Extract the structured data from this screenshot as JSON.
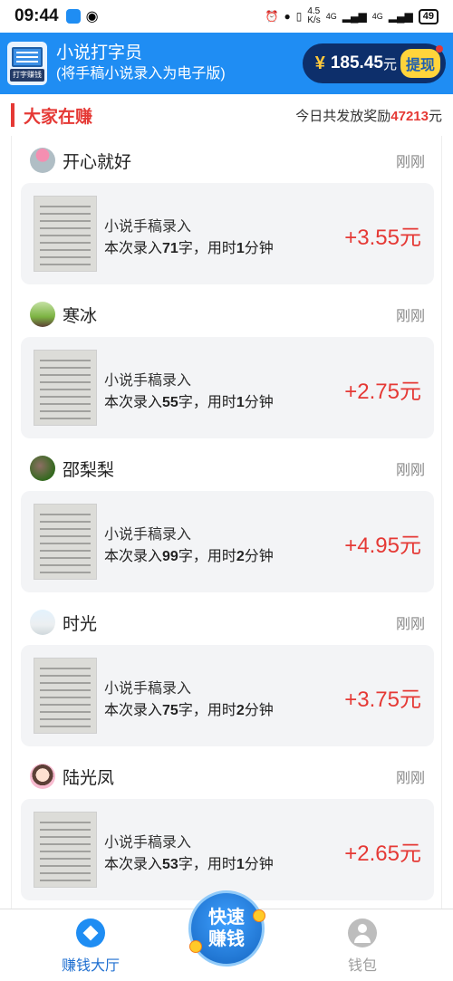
{
  "status_bar": {
    "time": "09:44",
    "network_speed": "4.5\nK/s",
    "signal_1": "4G",
    "signal_2": "4G",
    "battery": "49"
  },
  "header": {
    "app_logo_text": "打字赚钱",
    "title": "小说打字员",
    "subtitle": "(将手稿小说录入为电子版)",
    "currency_symbol": "¥",
    "balance": "185.45",
    "balance_unit": "元",
    "withdraw_label": "提现"
  },
  "section": {
    "title": "大家在赚",
    "reward_prefix": "今日共发放奖励",
    "reward_total": "47213",
    "reward_unit": "元"
  },
  "entries": [
    {
      "user": "开心就好",
      "time": "刚刚",
      "task": "小说手稿录入",
      "prefix": "本次录入",
      "chars": "71",
      "char_unit": "字",
      "sep": "，用时",
      "minutes": "1",
      "minute_unit": "分钟",
      "reward": "+3.55元"
    },
    {
      "user": "寒冰",
      "time": "刚刚",
      "task": "小说手稿录入",
      "prefix": "本次录入",
      "chars": "55",
      "char_unit": "字",
      "sep": "，用时",
      "minutes": "1",
      "minute_unit": "分钟",
      "reward": "+2.75元"
    },
    {
      "user": "邵梨梨",
      "time": "刚刚",
      "task": "小说手稿录入",
      "prefix": "本次录入",
      "chars": "99",
      "char_unit": "字",
      "sep": "，用时",
      "minutes": "2",
      "minute_unit": "分钟",
      "reward": "+4.95元"
    },
    {
      "user": "时光",
      "time": "刚刚",
      "task": "小说手稿录入",
      "prefix": "本次录入",
      "chars": "75",
      "char_unit": "字",
      "sep": "，用时",
      "minutes": "2",
      "minute_unit": "分钟",
      "reward": "+3.75元"
    },
    {
      "user": "陆光凤",
      "time": "刚刚",
      "task": "小说手稿录入",
      "prefix": "本次录入",
      "chars": "53",
      "char_unit": "字",
      "sep": "，用时",
      "minutes": "1",
      "minute_unit": "分钟",
      "reward": "+2.65元"
    }
  ],
  "bottom_nav": {
    "left_label": "赚钱大厅",
    "center_line1": "快速",
    "center_line2": "赚钱",
    "right_label": "钱包"
  }
}
